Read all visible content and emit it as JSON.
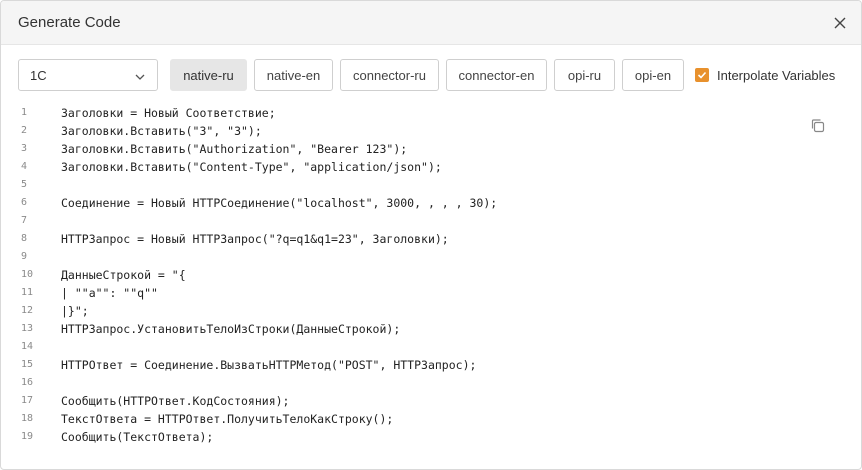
{
  "dialog": {
    "title": "Generate Code",
    "close_icon": "close-icon"
  },
  "language_select": {
    "value": "1C"
  },
  "variants": [
    {
      "label": "native-ru",
      "active": true
    },
    {
      "label": "native-en",
      "active": false
    },
    {
      "label": "connector-ru",
      "active": false
    },
    {
      "label": "connector-en",
      "active": false
    },
    {
      "label": "opi-ru",
      "active": false
    },
    {
      "label": "opi-en",
      "active": false
    }
  ],
  "interpolate": {
    "label": "Interpolate Variables",
    "checked": true
  },
  "code": {
    "copy_icon": "copy-icon",
    "lines": [
      {
        "n": "1",
        "text": "Заголовки = Новый Соответствие;"
      },
      {
        "n": "2",
        "text": "Заголовки.Вставить(\"3\", \"3\");"
      },
      {
        "n": "3",
        "text": "Заголовки.Вставить(\"Authorization\", \"Bearer 123\");"
      },
      {
        "n": "4",
        "text": "Заголовки.Вставить(\"Content-Type\", \"application/json\");"
      },
      {
        "n": "5",
        "text": ""
      },
      {
        "n": "6",
        "text": "Соединение = Новый HTTPСоединение(\"localhost\", 3000, , , , 30);"
      },
      {
        "n": "7",
        "text": ""
      },
      {
        "n": "8",
        "text": "HTTPЗапрос = Новый HTTPЗапрос(\"?q=q1&q1=23\", Заголовки);"
      },
      {
        "n": "9",
        "text": ""
      },
      {
        "n": "10",
        "text": "ДанныеСтрокой = \"{"
      },
      {
        "n": "11",
        "text": "| \"\"a\"\": \"\"q\"\""
      },
      {
        "n": "12",
        "text": "|}\";"
      },
      {
        "n": "13",
        "text": "HTTPЗапрос.УстановитьТелоИзСтроки(ДанныеСтрокой);"
      },
      {
        "n": "14",
        "text": ""
      },
      {
        "n": "15",
        "text": "HTTPОтвет = Соединение.ВызватьHTTPМетод(\"POST\", HTTPЗапрос);"
      },
      {
        "n": "16",
        "text": ""
      },
      {
        "n": "17",
        "text": "Сообщить(HTTPОтвет.КодСостояния);"
      },
      {
        "n": "18",
        "text": "ТекстОтвета = HTTPОтвет.ПолучитьТелоКакСтроку();"
      },
      {
        "n": "19",
        "text": "Сообщить(ТекстОтвета);"
      }
    ]
  },
  "colors": {
    "accent": "#e8912d",
    "active_button_bg": "#e6e6e6",
    "header_bg": "#f5f5f5"
  }
}
